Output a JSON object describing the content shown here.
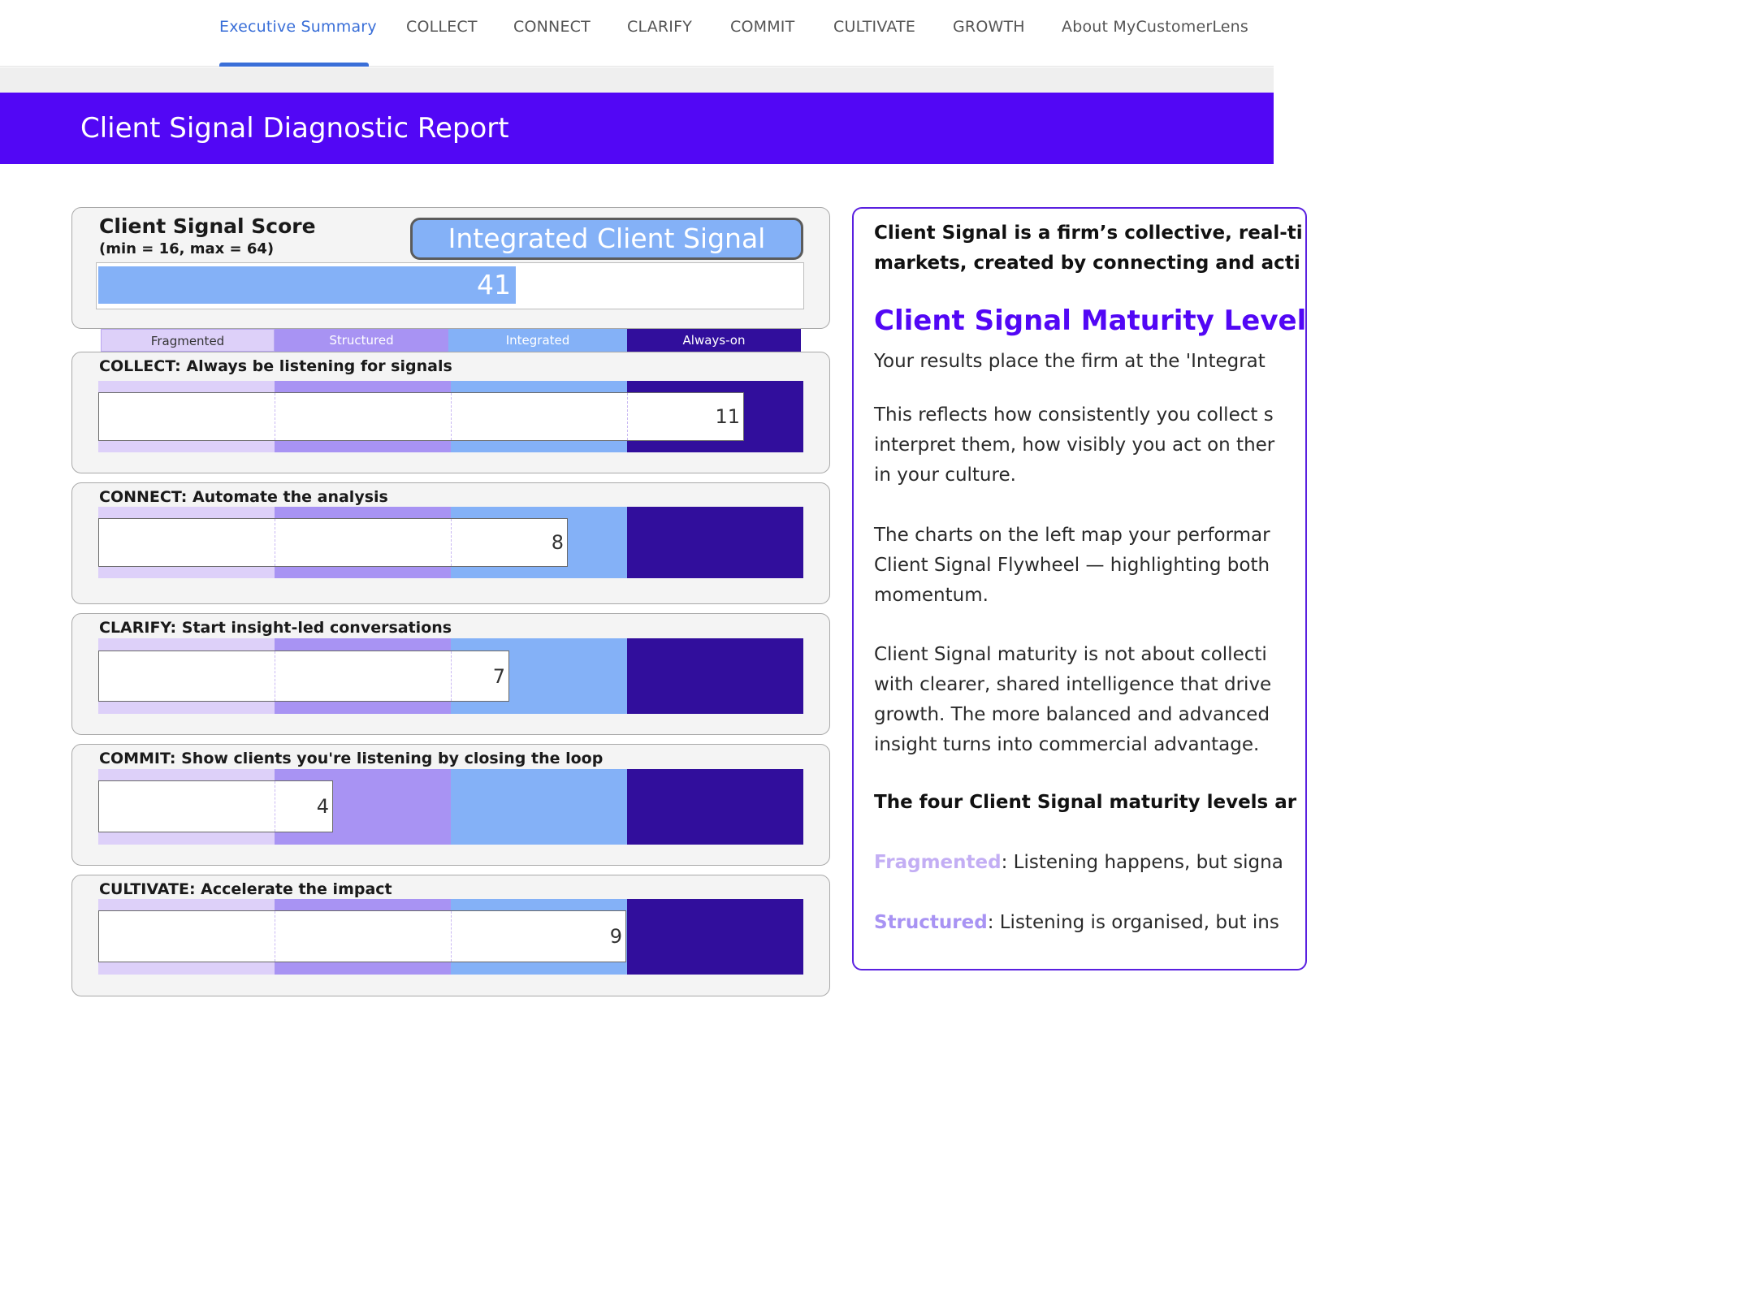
{
  "nav": {
    "tabs": [
      {
        "label": "Executive Summary",
        "active": true
      },
      {
        "label": "COLLECT"
      },
      {
        "label": "CONNECT"
      },
      {
        "label": "CLARIFY"
      },
      {
        "label": "COMMIT"
      },
      {
        "label": "CULTIVATE"
      },
      {
        "label": "GROWTH"
      },
      {
        "label": "About MyCustomerLens"
      }
    ]
  },
  "header": {
    "title": "Client Signal Diagnostic Report"
  },
  "score": {
    "title": "Client Signal Score",
    "range_note": "(min = 16, max = 64)",
    "level_label": "Integrated Client Signal",
    "value": "41",
    "min": 16,
    "max": 64
  },
  "levels": [
    {
      "label": "Fragmented",
      "bg": "#ddd0f9",
      "fg": "#333333"
    },
    {
      "label": "Structured",
      "bg": "#a893f3",
      "fg": "#ffffff"
    },
    {
      "label": "Integrated",
      "bg": "#84b1f7",
      "fg": "#ffffff"
    },
    {
      "label": "Always-on",
      "bg": "#310e9c",
      "fg": "#ffffff"
    }
  ],
  "pillars": [
    {
      "title": "COLLECT: Always be listening for signals",
      "value": "11"
    },
    {
      "title": "CONNECT: Automate the analysis",
      "value": "8"
    },
    {
      "title": "CLARIFY: Start insight-led conversations",
      "value": "7"
    },
    {
      "title": "COMMIT: Show clients you're listening by closing the loop",
      "value": "4"
    },
    {
      "title": "CULTIVATE: Accelerate the impact",
      "value": "9"
    }
  ],
  "right": {
    "intro_1": "Client Signal is a firm’s collective, real-ti",
    "intro_2": "markets, created by connecting and acti",
    "heading": "Client Signal Maturity Level",
    "p1": "Your results place the firm at the 'Integrat",
    "p2_1": "This reflects how consistently you collect s",
    "p2_2": "interpret them, how visibly you act on ther",
    "p2_3": "in your culture.",
    "p3_1": "The charts on the left map your performar",
    "p3_2": "Client Signal Flywheel — highlighting both",
    "p3_3": "momentum.",
    "p4_1": "Client Signal maturity is not about collecti",
    "p4_2": "with clearer, shared intelligence that drive",
    "p4_3": "growth. The more balanced and advanced",
    "p4_4": "insight turns into commercial advantage.",
    "levels_heading": "The four Client Signal maturity levels ar",
    "def1_level": "Fragmented",
    "def1_text": ": Listening happens, but signa",
    "def2_level": "Structured",
    "def2_text": ": Listening is organised, but ins"
  }
}
